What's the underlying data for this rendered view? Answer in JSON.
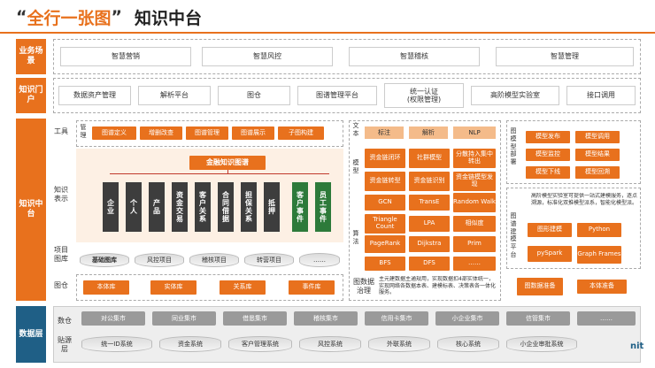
{
  "title": {
    "quote_open": "“",
    "highlight": "全行一张图",
    "quote_close": "”",
    "rest": "知识中台"
  },
  "rows": {
    "business": "业务场景",
    "portal": "知识门户",
    "center": "知识中台",
    "data": "数据层"
  },
  "business_scenes": [
    "智慧营销",
    "智慧风控",
    "智慧稽核",
    "智慧管理"
  ],
  "portal_items": [
    "数据资产管理",
    "解析平台",
    "图仓",
    "图谱管理平台",
    "统一认证\n(权限管理)",
    "高阶模型实验室",
    "接口调用"
  ],
  "tools": {
    "label": "工具",
    "mgmt_label": "管理",
    "items": [
      "图谱定义",
      "增删改查",
      "图谱管理",
      "图谱展示",
      "子图构建"
    ]
  },
  "knowledge": {
    "label": "知识表示",
    "header": "金融知识图谱",
    "entities": [
      "企业",
      "个人",
      "产品",
      "资金交易",
      "客户关系",
      "合同借据",
      "担保关系",
      "抵押",
      "客户事件",
      "员工事件"
    ]
  },
  "project_lib": {
    "label": "项目图库",
    "items": [
      "基础图库",
      "风控项目",
      "稽核项目",
      "转营项目",
      "……"
    ]
  },
  "graph_store": {
    "label": "图仓",
    "items": [
      "本体库",
      "实体库",
      "关系库",
      "事件库"
    ]
  },
  "text": {
    "label": "文本",
    "items": [
      "标注",
      "解析",
      "NLP"
    ]
  },
  "model": {
    "label": "模型",
    "items": [
      "资金链闭环",
      "社群模型",
      "分散持入集中转出",
      "资金链转型",
      "资金链识别",
      "资金链模型发现"
    ]
  },
  "algo": {
    "label": "算法",
    "items": [
      "GCN",
      "TransE",
      "Random Walk",
      "Triangle Count",
      "LPA",
      "相似度",
      "PageRank",
      "Dijkstra",
      "Prim",
      "BFS",
      "DFS",
      "……"
    ]
  },
  "governance": {
    "label": "图数据治理",
    "desc": "主元建数据主通规用，实现数据扣4部实体统一，实现网络各数据本表、建模标表、决策表各一体化服务。",
    "buttons": [
      "图数据准备",
      "本体准备"
    ]
  },
  "model_deploy": {
    "label": "图模型部署",
    "items": [
      "模型发布",
      "模型调用",
      "模型监控",
      "模型结果",
      "模型下线",
      "模型回溯"
    ]
  },
  "lab": {
    "label": "图谱建模平台",
    "desc": "高阶模型实验室可提供一站式建模服务，逐点溯源，标准化双推模型派系，智能化模型派。",
    "items": [
      "图形建模",
      "Python",
      "pySpark",
      "Graph Frames"
    ]
  },
  "data_layer": {
    "label_mart": "数仓",
    "label_src": "贴源层",
    "mart": [
      "对公集市",
      "同业集市",
      "借恳集市",
      "稽核集市",
      "信用卡集市",
      "小企业集市",
      "信管集市",
      "……"
    ],
    "src": [
      "统一ID系统",
      "资金系统",
      "客户管理系统",
      "风控系统",
      "外联系统",
      "核心系统",
      "小企业审批系统"
    ]
  },
  "corner": "nit"
}
